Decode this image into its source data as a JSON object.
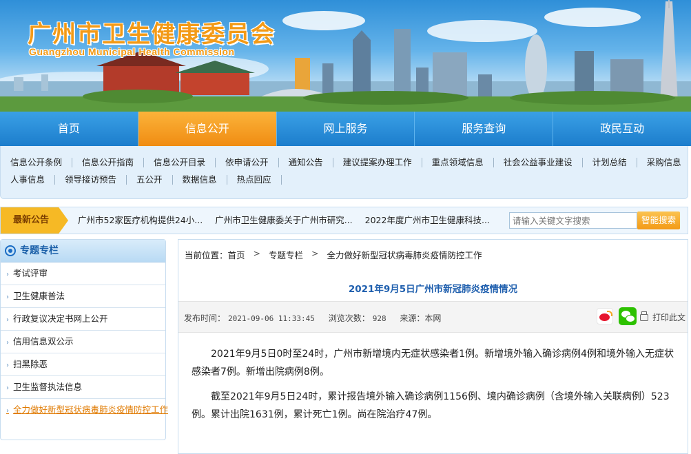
{
  "header": {
    "org_name_cn": "广州市卫生健康委员会",
    "org_name_en": "Guangzhou Municipal Health Commission"
  },
  "nav": {
    "items": [
      {
        "label": "首页"
      },
      {
        "label": "信息公开",
        "active": true
      },
      {
        "label": "网上服务"
      },
      {
        "label": "服务查询"
      },
      {
        "label": "政民互动"
      }
    ]
  },
  "subnav": {
    "row1": [
      "信息公开条例",
      "信息公开指南",
      "信息公开目录",
      "依申请公开",
      "通知公告",
      "建议提案办理工作",
      "重点领域信息",
      "社会公益事业建设",
      "计划总结",
      "采购信息"
    ],
    "row2": [
      "人事信息",
      "领导接访预告",
      "五公开",
      "数据信息",
      "热点回应"
    ]
  },
  "notice": {
    "label": "最新公告",
    "items": [
      "广州市52家医疗机构提供24小...",
      "广州市卫生健康委关于广州市研究...",
      "2022年度广州市卫生健康科技..."
    ],
    "search_placeholder": "请输入关键文字搜索",
    "search_button": "智能搜索"
  },
  "sidebar": {
    "title": "专题专栏",
    "items": [
      {
        "label": "考试评审"
      },
      {
        "label": "卫生健康普法"
      },
      {
        "label": "行政复议决定书网上公开"
      },
      {
        "label": "信用信息双公示"
      },
      {
        "label": "扫黑除恶"
      },
      {
        "label": "卫生监督执法信息"
      },
      {
        "label": "全力做好新型冠状病毒肺炎疫情防控工作",
        "current": true
      }
    ]
  },
  "breadcrumb": {
    "prefix": "当前位置：",
    "items": [
      "首页",
      "专题专栏",
      "全力做好新型冠状病毒肺炎疫情防控工作"
    ]
  },
  "article": {
    "title": "2021年9月5日广州市新冠肺炎疫情情况",
    "publish_label": "发布时间：",
    "publish_time": "2021-09-06 11:33:45",
    "views_label": "浏览次数：",
    "views": "928",
    "source_label": "来源：",
    "source": "本网",
    "print_label": "打印此文",
    "paragraphs": [
      "2021年9月5日0时至24时，广州市新增境内无症状感染者1例。新增境外输入确诊病例4例和境外输入无症状感染者7例。新增出院病例8例。",
      "截至2021年9月5日24时，累计报告境外输入确诊病例1156例、境内确诊病例（含境外输入关联病例）523例。累计出院1631例，累计死亡1例。尚在院治疗47例。"
    ]
  },
  "colors": {
    "nav_blue": "#1c7dcc",
    "nav_active_orange": "#f08c12",
    "title_blue": "#1f5fae",
    "notice_yellow": "#f6b925",
    "current_link_orange": "#e07a00"
  }
}
